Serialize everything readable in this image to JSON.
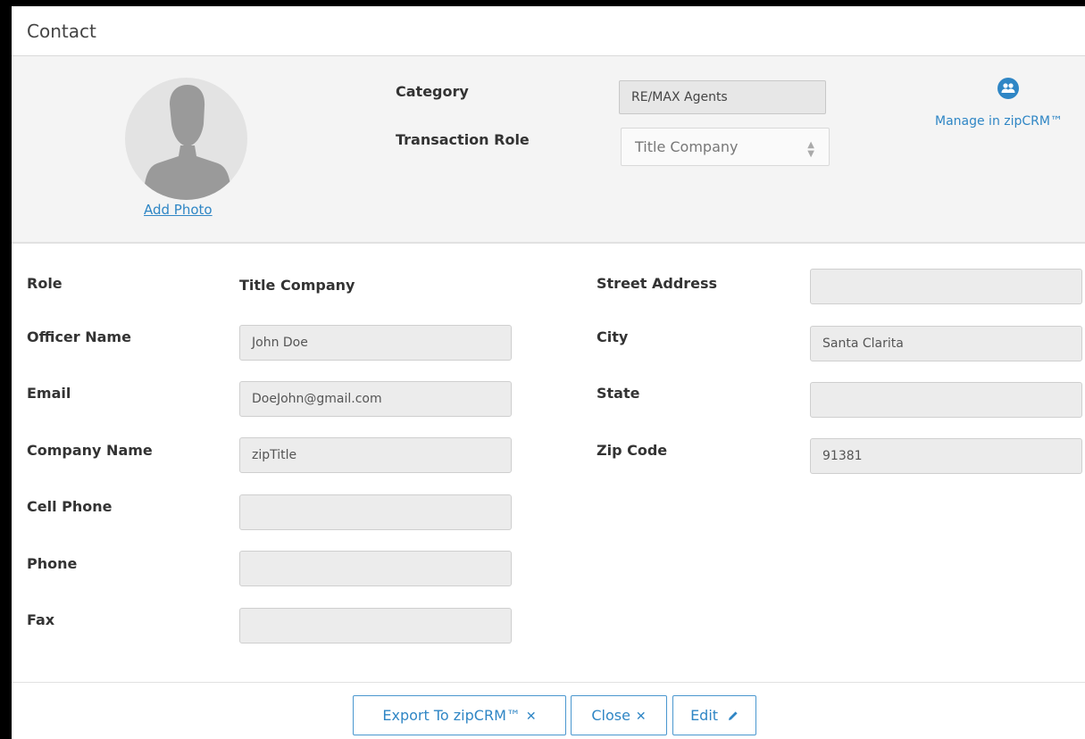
{
  "window": {
    "title": "Contact"
  },
  "photo": {
    "add_label": "Add Photo"
  },
  "header": {
    "category_label": "Category",
    "category_value": "RE/MAX Agents",
    "transaction_role_label": "Transaction Role",
    "transaction_role_value": "Title Company",
    "manage_link": "Manage in zipCRM™"
  },
  "left_fields": {
    "role_label": "Role",
    "role_value": "Title Company",
    "officer_label": "Officer Name",
    "officer_value": "John Doe",
    "email_label": "Email",
    "email_value": "DoeJohn@gmail.com",
    "company_label": "Company Name",
    "company_value": "zipTitle",
    "cell_label": "Cell Phone",
    "cell_value": "",
    "phone_label": "Phone",
    "phone_value": "",
    "fax_label": "Fax",
    "fax_value": ""
  },
  "right_fields": {
    "street_label": "Street Address",
    "street_value": "",
    "city_label": "City",
    "city_value": "Santa Clarita",
    "state_label": "State",
    "state_value": "",
    "zip_label": "Zip Code",
    "zip_value": "91381"
  },
  "footer": {
    "export_label": "Export To zipCRM™",
    "close_label": "Close",
    "edit_label": "Edit"
  },
  "icons": {
    "export": "close-icon",
    "close": "close-icon",
    "edit": "pencil-icon",
    "crm": "people-icon"
  },
  "colors": {
    "accent": "#2f86c5",
    "panel": "#f4f4f4",
    "input_bg": "#ececec"
  }
}
